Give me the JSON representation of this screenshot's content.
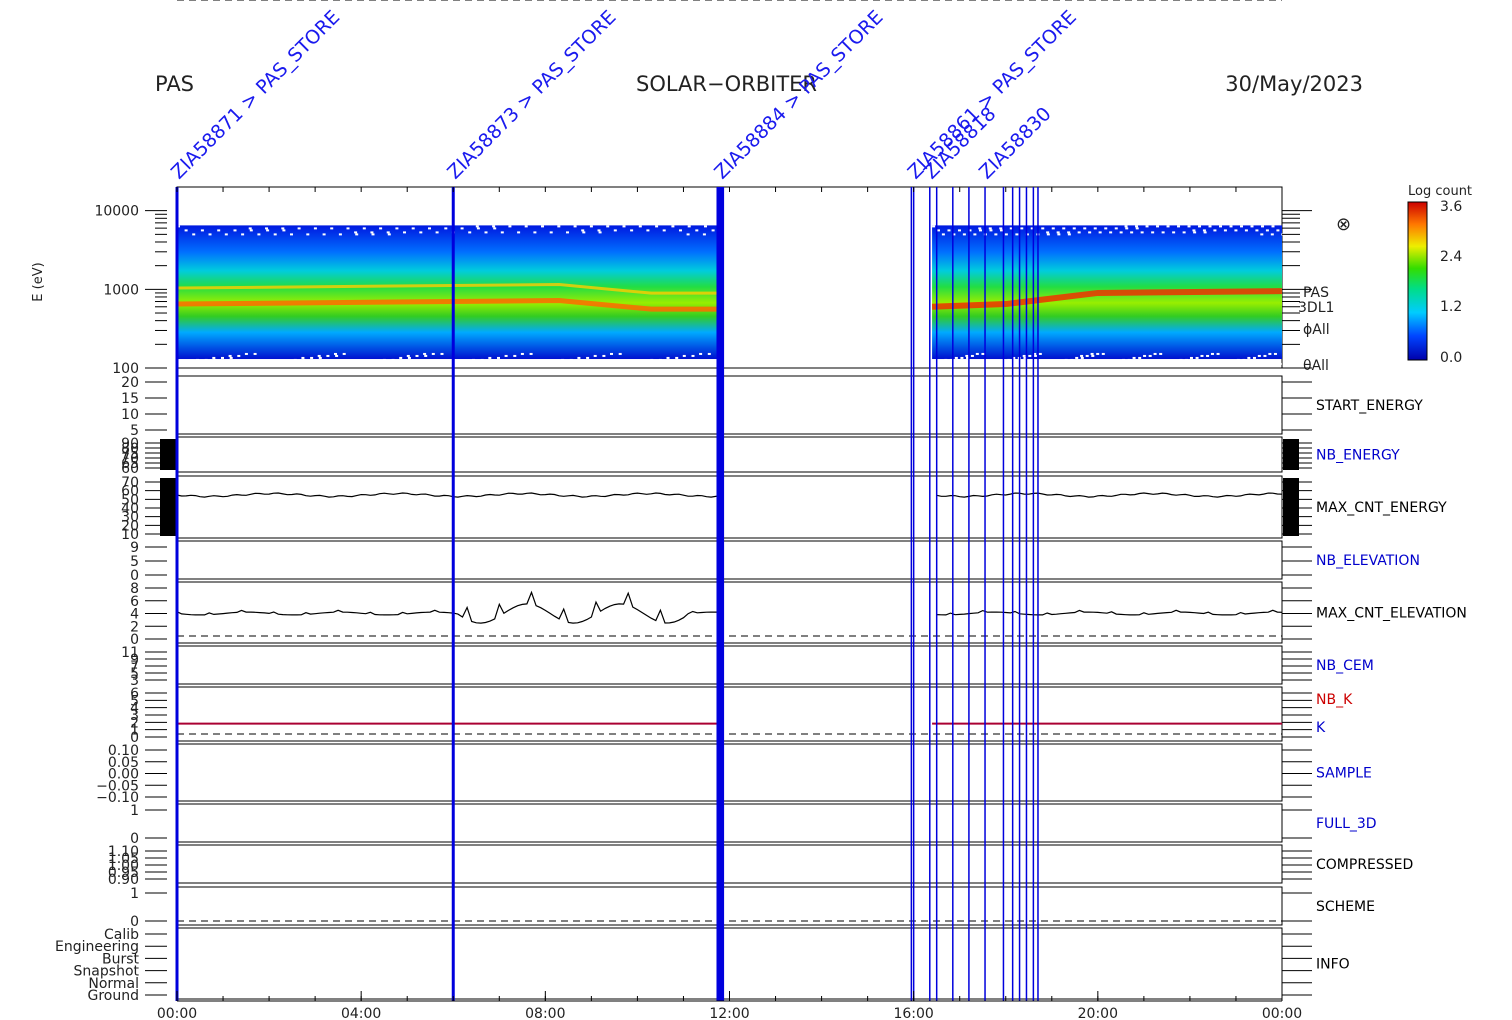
{
  "header": {
    "instrument": "PAS",
    "mission": "SOLAR−ORBITER",
    "date": "30/May/2023"
  },
  "colorbar": {
    "title": "Log count",
    "ticks": [
      "3.6",
      "2.4",
      "1.2",
      "0.0"
    ]
  },
  "panel_info": {
    "symbol": "⊗",
    "lines": [
      "PAS",
      "3DL1",
      "ϕAll",
      "θAll"
    ]
  },
  "chart_data": {
    "type": "spectrogram-stack",
    "x_axis": {
      "range": [
        "00:00",
        "24:00"
      ],
      "tick_labels": [
        "00:00",
        "04:00",
        "08:00",
        "12:00",
        "16:00",
        "20:00",
        "00:00"
      ]
    },
    "spectrogram": {
      "ylabel": "E (eV)",
      "scale": "log",
      "ylim": [
        100,
        20000
      ],
      "tick_labels": [
        "10000",
        "1000",
        "100"
      ],
      "data_intervals_hours": [
        [
          0.0,
          11.8
        ],
        [
          16.4,
          24.0
        ]
      ],
      "peak_energy_eV": [
        [
          0,
          650
        ],
        [
          6,
          700
        ],
        [
          8.3,
          720
        ],
        [
          10.3,
          560
        ],
        [
          11.8,
          560
        ],
        [
          16.4,
          600
        ],
        [
          18,
          650
        ],
        [
          20,
          900
        ],
        [
          24,
          950
        ]
      ],
      "colorscale": "Log count",
      "zlim": [
        0.0,
        3.6
      ]
    },
    "panels": [
      {
        "name": "START_ENERGY",
        "label_color": "#000000",
        "ticks": [
          "20",
          "15",
          "10",
          "5"
        ]
      },
      {
        "name": "NB_ENERGY",
        "label_color": "#0000cc",
        "ticks": [
          "90",
          "80",
          "75",
          "70",
          "65",
          "60"
        ]
      },
      {
        "name": "MAX_CNT_ENERGY",
        "label_color": "#000000",
        "ticks": [
          "70",
          "60",
          "50",
          "40",
          "30",
          "20",
          "10"
        ],
        "approx_value": 55
      },
      {
        "name": "NB_ELEVATION",
        "label_color": "#0000cc",
        "ticks": [
          "9",
          "5",
          "0"
        ]
      },
      {
        "name": "MAX_CNT_ELEVATION",
        "label_color": "#000000",
        "ticks": [
          "8",
          "6",
          "4",
          "2",
          "0"
        ],
        "approx_value": 4
      },
      {
        "name": "NB_CEM",
        "label_color": "#0000cc",
        "ticks": [
          "11",
          "9",
          "7",
          "5",
          "3"
        ]
      },
      {
        "name": "NB_K / K",
        "labels": [
          "NB_K",
          "K"
        ],
        "label_colors": [
          "#cc0000",
          "#0000cc"
        ],
        "ticks": [
          "6",
          "5",
          "4",
          "3",
          "2",
          "1",
          "0"
        ],
        "approx_value": 1
      },
      {
        "name": "SAMPLE",
        "label_color": "#0000cc",
        "ticks": [
          "0.10",
          "0.05",
          "0.00",
          "−0.05",
          "−0.10"
        ],
        "approx_value": 0
      },
      {
        "name": "FULL_3D",
        "label_color": "#0000cc",
        "ticks": [
          "1",
          "0"
        ]
      },
      {
        "name": "COMPRESSED",
        "label_color": "#000000",
        "ticks": [
          "1.10",
          "1.05",
          "1.00",
          "0.95",
          "0.90"
        ]
      },
      {
        "name": "SCHEME",
        "label_color": "#000000",
        "ticks": [
          "1",
          "0"
        ],
        "approx_value": 0
      },
      {
        "name": "INFO",
        "label_color": "#000000",
        "ticks": [
          "Calib",
          "Engineering",
          "Burst",
          "Snapshot",
          "Normal",
          "Ground"
        ]
      }
    ],
    "annotations": {
      "markers_hours": [
        0.0,
        6.0,
        11.75,
        11.8,
        11.85,
        15.95,
        16.0,
        16.35,
        16.5,
        16.85,
        17.2,
        17.55,
        17.95,
        18.15,
        18.3,
        18.45,
        18.6,
        18.7
      ],
      "labels": [
        {
          "text": "ZIA58871 > PAS_STORE",
          "hour": 0.0
        },
        {
          "text": "ZIA58873 > PAS_STORE",
          "hour": 6.0
        },
        {
          "text": "ZIA58884 > PAS_STORE",
          "hour": 11.8
        },
        {
          "text": "ZIA58861 > PAS_STORE",
          "hour": 16.0
        },
        {
          "text": "ZIA58818",
          "hour": 16.35
        },
        {
          "text": "ZIA58830",
          "hour": 17.55
        }
      ]
    }
  }
}
